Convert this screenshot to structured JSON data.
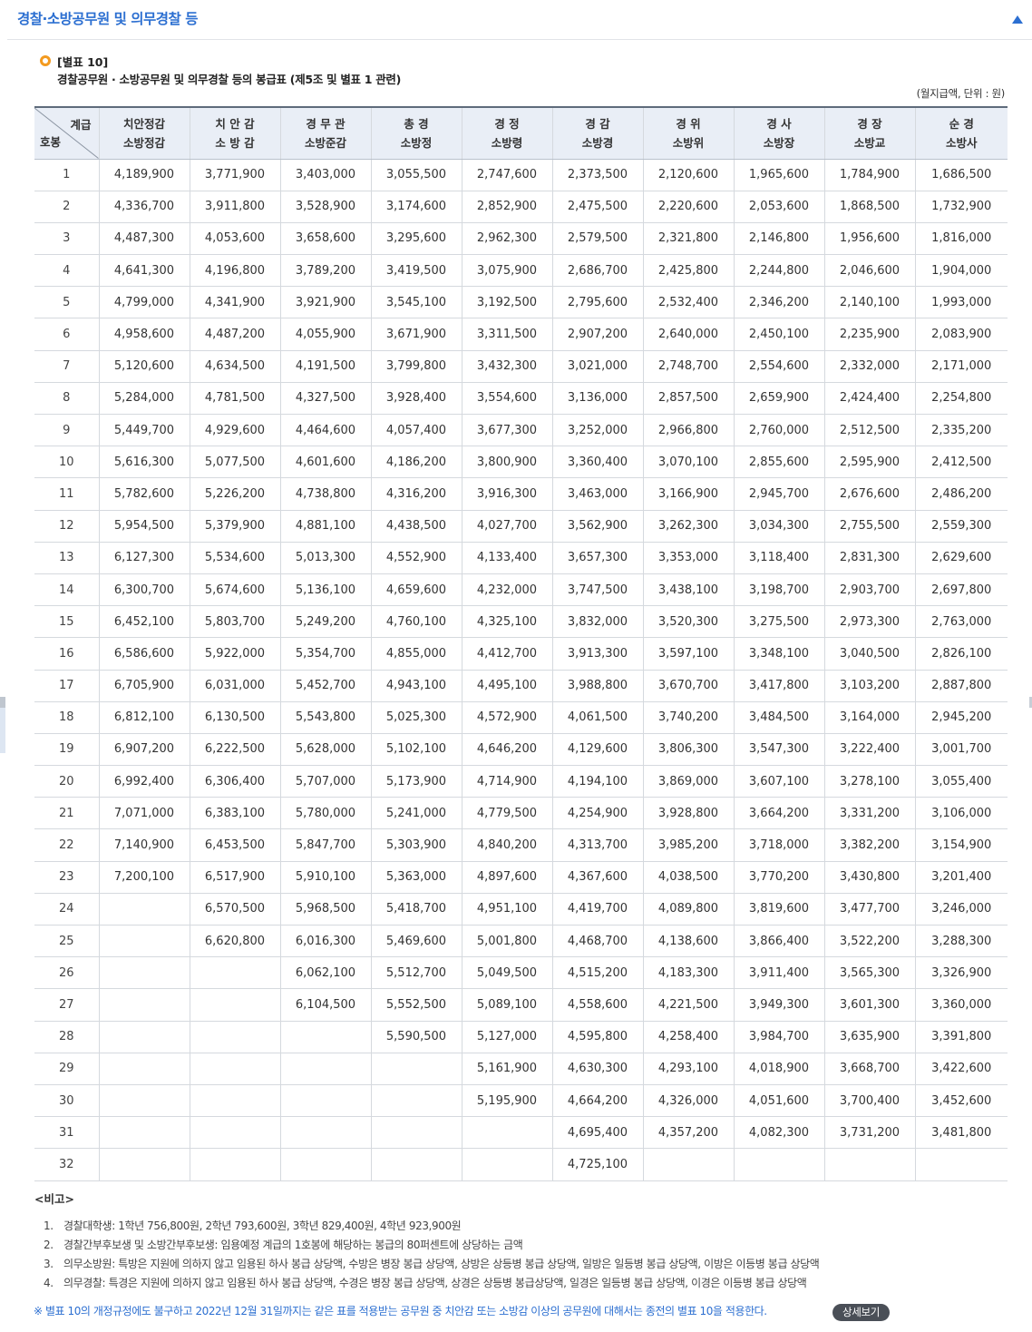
{
  "header": {
    "title": "경찰·소방공무원 및 의무경찰 등"
  },
  "table_no": "[별표 10]",
  "table_title": "경찰공무원 · 소방공무원 및 의무경찰 등의 봉급표 (제5조 및 별표 1 관련)",
  "unit": "(월지급액, 단위 : 원)",
  "corner": {
    "top": "계급",
    "bottom": "호봉"
  },
  "columns": [
    [
      "치안정감",
      "소방정감"
    ],
    [
      "치 안 감",
      "소 방 감"
    ],
    [
      "경 무 관",
      "소방준감"
    ],
    [
      "총 경",
      "소방정"
    ],
    [
      "경 정",
      "소방령"
    ],
    [
      "경 감",
      "소방경"
    ],
    [
      "경 위",
      "소방위"
    ],
    [
      "경 사",
      "소방장"
    ],
    [
      "경 장",
      "소방교"
    ],
    [
      "순 경",
      "소방사"
    ]
  ],
  "rows": [
    [
      "1",
      "4,189,900",
      "3,771,900",
      "3,403,000",
      "3,055,500",
      "2,747,600",
      "2,373,500",
      "2,120,600",
      "1,965,600",
      "1,784,900",
      "1,686,500"
    ],
    [
      "2",
      "4,336,700",
      "3,911,800",
      "3,528,900",
      "3,174,600",
      "2,852,900",
      "2,475,500",
      "2,220,600",
      "2,053,600",
      "1,868,500",
      "1,732,900"
    ],
    [
      "3",
      "4,487,300",
      "4,053,600",
      "3,658,600",
      "3,295,600",
      "2,962,300",
      "2,579,500",
      "2,321,800",
      "2,146,800",
      "1,956,600",
      "1,816,000"
    ],
    [
      "4",
      "4,641,300",
      "4,196,800",
      "3,789,200",
      "3,419,500",
      "3,075,900",
      "2,686,700",
      "2,425,800",
      "2,244,800",
      "2,046,600",
      "1,904,000"
    ],
    [
      "5",
      "4,799,000",
      "4,341,900",
      "3,921,900",
      "3,545,100",
      "3,192,500",
      "2,795,600",
      "2,532,400",
      "2,346,200",
      "2,140,100",
      "1,993,000"
    ],
    [
      "6",
      "4,958,600",
      "4,487,200",
      "4,055,900",
      "3,671,900",
      "3,311,500",
      "2,907,200",
      "2,640,000",
      "2,450,100",
      "2,235,900",
      "2,083,900"
    ],
    [
      "7",
      "5,120,600",
      "4,634,500",
      "4,191,500",
      "3,799,800",
      "3,432,300",
      "3,021,000",
      "2,748,700",
      "2,554,600",
      "2,332,000",
      "2,171,000"
    ],
    [
      "8",
      "5,284,000",
      "4,781,500",
      "4,327,500",
      "3,928,400",
      "3,554,600",
      "3,136,000",
      "2,857,500",
      "2,659,900",
      "2,424,400",
      "2,254,800"
    ],
    [
      "9",
      "5,449,700",
      "4,929,600",
      "4,464,600",
      "4,057,400",
      "3,677,300",
      "3,252,000",
      "2,966,800",
      "2,760,000",
      "2,512,500",
      "2,335,200"
    ],
    [
      "10",
      "5,616,300",
      "5,077,500",
      "4,601,600",
      "4,186,200",
      "3,800,900",
      "3,360,400",
      "3,070,100",
      "2,855,600",
      "2,595,900",
      "2,412,500"
    ],
    [
      "11",
      "5,782,600",
      "5,226,200",
      "4,738,800",
      "4,316,200",
      "3,916,300",
      "3,463,000",
      "3,166,900",
      "2,945,700",
      "2,676,600",
      "2,486,200"
    ],
    [
      "12",
      "5,954,500",
      "5,379,900",
      "4,881,100",
      "4,438,500",
      "4,027,700",
      "3,562,900",
      "3,262,300",
      "3,034,300",
      "2,755,500",
      "2,559,300"
    ],
    [
      "13",
      "6,127,300",
      "5,534,600",
      "5,013,300",
      "4,552,900",
      "4,133,400",
      "3,657,300",
      "3,353,000",
      "3,118,400",
      "2,831,300",
      "2,629,600"
    ],
    [
      "14",
      "6,300,700",
      "5,674,600",
      "5,136,100",
      "4,659,600",
      "4,232,000",
      "3,747,500",
      "3,438,100",
      "3,198,700",
      "2,903,700",
      "2,697,800"
    ],
    [
      "15",
      "6,452,100",
      "5,803,700",
      "5,249,200",
      "4,760,100",
      "4,325,100",
      "3,832,000",
      "3,520,300",
      "3,275,500",
      "2,973,300",
      "2,763,000"
    ],
    [
      "16",
      "6,586,600",
      "5,922,000",
      "5,354,700",
      "4,855,000",
      "4,412,700",
      "3,913,300",
      "3,597,100",
      "3,348,100",
      "3,040,500",
      "2,826,100"
    ],
    [
      "17",
      "6,705,900",
      "6,031,000",
      "5,452,700",
      "4,943,100",
      "4,495,100",
      "3,988,800",
      "3,670,700",
      "3,417,800",
      "3,103,200",
      "2,887,800"
    ],
    [
      "18",
      "6,812,100",
      "6,130,500",
      "5,543,800",
      "5,025,300",
      "4,572,900",
      "4,061,500",
      "3,740,200",
      "3,484,500",
      "3,164,000",
      "2,945,200"
    ],
    [
      "19",
      "6,907,200",
      "6,222,500",
      "5,628,000",
      "5,102,100",
      "4,646,200",
      "4,129,600",
      "3,806,300",
      "3,547,300",
      "3,222,400",
      "3,001,700"
    ],
    [
      "20",
      "6,992,400",
      "6,306,400",
      "5,707,000",
      "5,173,900",
      "4,714,900",
      "4,194,100",
      "3,869,000",
      "3,607,100",
      "3,278,100",
      "3,055,400"
    ],
    [
      "21",
      "7,071,000",
      "6,383,100",
      "5,780,000",
      "5,241,000",
      "4,779,500",
      "4,254,900",
      "3,928,800",
      "3,664,200",
      "3,331,200",
      "3,106,000"
    ],
    [
      "22",
      "7,140,900",
      "6,453,500",
      "5,847,700",
      "5,303,900",
      "4,840,200",
      "4,313,700",
      "3,985,200",
      "3,718,000",
      "3,382,200",
      "3,154,900"
    ],
    [
      "23",
      "7,200,100",
      "6,517,900",
      "5,910,100",
      "5,363,000",
      "4,897,600",
      "4,367,600",
      "4,038,500",
      "3,770,200",
      "3,430,800",
      "3,201,400"
    ],
    [
      "24",
      "",
      "6,570,500",
      "5,968,500",
      "5,418,700",
      "4,951,100",
      "4,419,700",
      "4,089,800",
      "3,819,600",
      "3,477,700",
      "3,246,000"
    ],
    [
      "25",
      "",
      "6,620,800",
      "6,016,300",
      "5,469,600",
      "5,001,800",
      "4,468,700",
      "4,138,600",
      "3,866,400",
      "3,522,200",
      "3,288,300"
    ],
    [
      "26",
      "",
      "",
      "6,062,100",
      "5,512,700",
      "5,049,500",
      "4,515,200",
      "4,183,300",
      "3,911,400",
      "3,565,300",
      "3,326,900"
    ],
    [
      "27",
      "",
      "",
      "6,104,500",
      "5,552,500",
      "5,089,100",
      "4,558,600",
      "4,221,500",
      "3,949,300",
      "3,601,300",
      "3,360,000"
    ],
    [
      "28",
      "",
      "",
      "",
      "5,590,500",
      "5,127,000",
      "4,595,800",
      "4,258,400",
      "3,984,700",
      "3,635,900",
      "3,391,800"
    ],
    [
      "29",
      "",
      "",
      "",
      "",
      "5,161,900",
      "4,630,300",
      "4,293,100",
      "4,018,900",
      "3,668,700",
      "3,422,600"
    ],
    [
      "30",
      "",
      "",
      "",
      "",
      "5,195,900",
      "4,664,200",
      "4,326,000",
      "4,051,600",
      "3,700,400",
      "3,452,600"
    ],
    [
      "31",
      "",
      "",
      "",
      "",
      "",
      "4,695,400",
      "4,357,200",
      "4,082,300",
      "3,731,200",
      "3,481,800"
    ],
    [
      "32",
      "",
      "",
      "",
      "",
      "",
      "4,725,100",
      "",
      "",
      "",
      ""
    ]
  ],
  "notes_heading": "<비고>",
  "notes": [
    {
      "num": "1.",
      "text": "경찰대학생: 1학년 756,800원, 2학년 793,600원, 3학년 829,400원, 4학년 923,900원"
    },
    {
      "num": "2.",
      "text": "경찰간부후보생 및 소방간부후보생: 임용예정 계급의 1호봉에 해당하는 봉급의 80퍼센트에 상당하는 금액"
    },
    {
      "num": "3.",
      "text": "의무소방원: 특방은 지원에 의하지 않고 임용된 하사 봉급 상당액, 수방은 병장 봉급 상당액, 상방은 상등병 봉급 상당액, 일방은 일등병 봉급 상당액, 이방은 이등병 봉급 상당액"
    },
    {
      "num": "4.",
      "text": "의무경찰: 특경은 지원에 의하지 않고 임용된 하사 봉급 상당액, 수경은 병장 봉급 상당액, 상경은 상등병 봉급상당액, 일경은 일등병 봉급 상당액, 이경은 이등병 봉급 상당액"
    }
  ],
  "footnote": "※  별표 10의 개정규정에도 불구하고 2022년 12월 31일까지는 같은 표를 적용받는 공무원 중 치안감 또는 소방감 이상의 공무원에 대해서는 종전의 별표 10을 적용한다.",
  "detail_button": "상세보기"
}
